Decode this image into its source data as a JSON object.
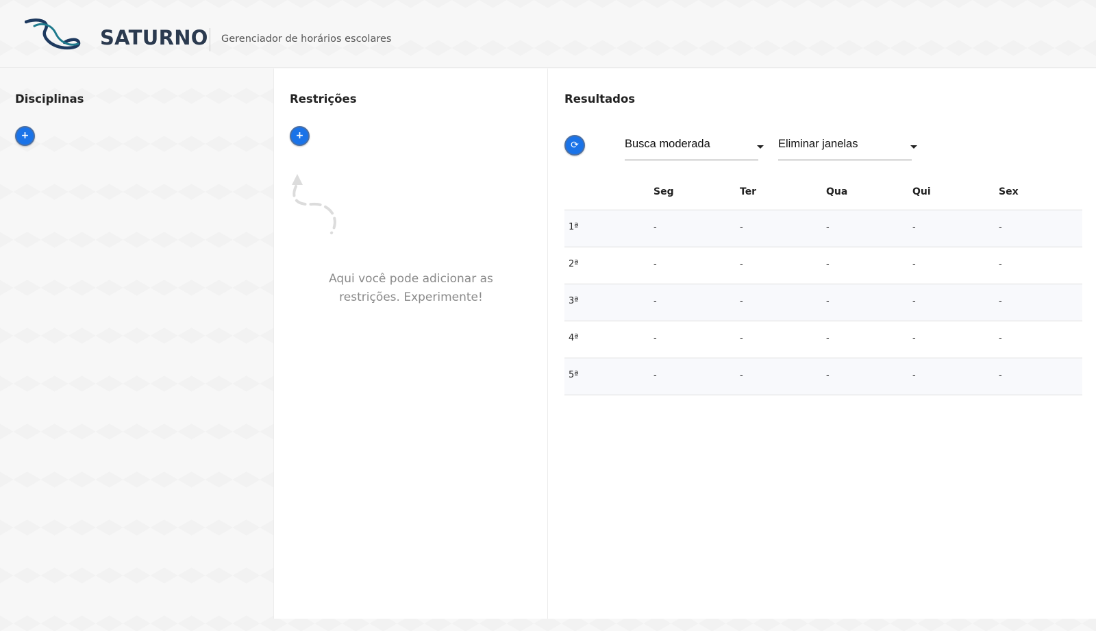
{
  "app": {
    "brand": "SATURNO",
    "tagline": "Gerenciador de horários escolares",
    "logo_icon": "saturn-logo-icon"
  },
  "panels": {
    "disciplinas": {
      "title": "Disciplinas",
      "add_label": "+"
    },
    "restricoes": {
      "title": "Restrições",
      "add_label": "+",
      "hint": "Aqui você pode adicionar as restrições. Experimente!",
      "hint_icon": "dashed-arrow-icon"
    },
    "resultados": {
      "title": "Resultados",
      "refresh_label": "⟳",
      "search_mode": {
        "selected": "Busca moderada"
      },
      "window_mode": {
        "selected": "Eliminar janelas"
      }
    }
  },
  "schedule": {
    "days": [
      "Seg",
      "Ter",
      "Qua",
      "Qui",
      "Sex"
    ],
    "periods": [
      "1ª",
      "2ª",
      "3ª",
      "4ª",
      "5ª"
    ],
    "cells": [
      [
        "-",
        "-",
        "-",
        "-",
        "-"
      ],
      [
        "-",
        "-",
        "-",
        "-",
        "-"
      ],
      [
        "-",
        "-",
        "-",
        "-",
        "-"
      ],
      [
        "-",
        "-",
        "-",
        "-",
        "-"
      ],
      [
        "-",
        "-",
        "-",
        "-",
        "-"
      ]
    ]
  },
  "colors": {
    "accent": "#1a73e8",
    "brand_text": "#2b3a4f",
    "logo_dark": "#1e3a5f",
    "logo_teal": "#1f7a8c"
  }
}
